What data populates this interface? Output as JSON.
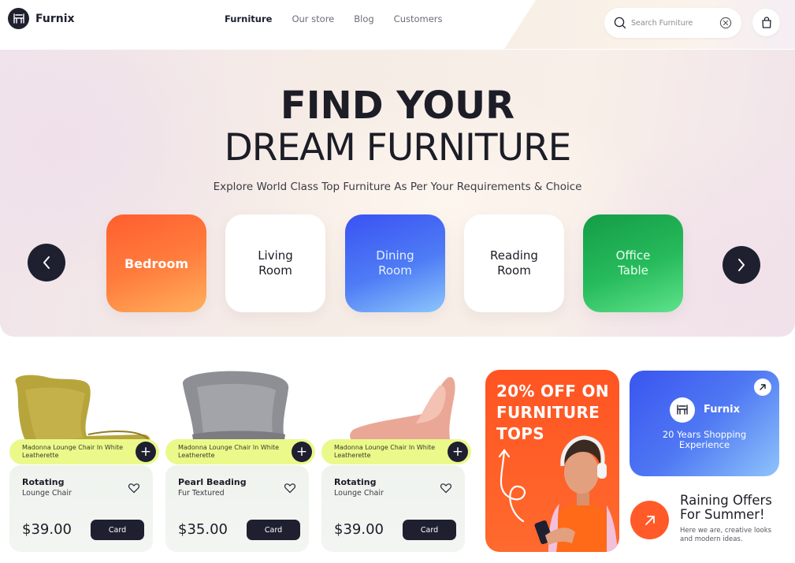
{
  "header": {
    "logo_text": "Furnix",
    "nav": [
      "Furniture",
      "Our store",
      "Blog",
      "Customers"
    ],
    "active_nav": "Furniture",
    "search_placeholder": "Search Furniture"
  },
  "hero": {
    "title_line1": "FIND YOUR",
    "title_line2": "DREAM FURNITURE",
    "subtitle": "Explore World Class Top Furniture As Per Your Requirements & Choice",
    "categories": [
      {
        "label": "Bedroom",
        "color": "#ff6a30"
      },
      {
        "label": "Living\nRoom",
        "color": "#ffffff"
      },
      {
        "label": "Dining\nRoom",
        "color": "#4468f4"
      },
      {
        "label": "Reading\nRoom",
        "color": "#ffffff"
      },
      {
        "label": "Office\nTable",
        "color": "#21b454"
      }
    ]
  },
  "products": [
    {
      "tag": "Madonna Lounge Chair In White Leatherette",
      "name": "Rotating",
      "sub": "Lounge Chair",
      "price": "$39.00",
      "button": "Card",
      "chair_color": "#b3a23a"
    },
    {
      "tag": "Madonna Lounge Chair In White Leatherette",
      "name": "Pearl Beading",
      "sub": "Fur Textured",
      "price": "$35.00",
      "button": "Card",
      "chair_color": "#8d8e93"
    },
    {
      "tag": "Madonna Lounge Chair In White Leatherette",
      "name": "Rotating",
      "sub": "Lounge Chair",
      "price": "$39.00",
      "button": "Card",
      "chair_color": "#e9a998"
    }
  ],
  "promo": {
    "text": "20% OFF ON\nFURNITURE\nTOPS"
  },
  "brand_card": {
    "name": "Furnix",
    "description": "20 Years Shopping\nExperience"
  },
  "offer": {
    "title": "Raining Offers\nFor Summer!",
    "description": "Here we are, creative looks\nand modern ideas."
  },
  "colors": {
    "dark": "#1e2030",
    "accent_orange": "#ff5a28",
    "accent_lime": "#eaf98a",
    "accent_blue": "#4468f4",
    "accent_green": "#21b454"
  }
}
